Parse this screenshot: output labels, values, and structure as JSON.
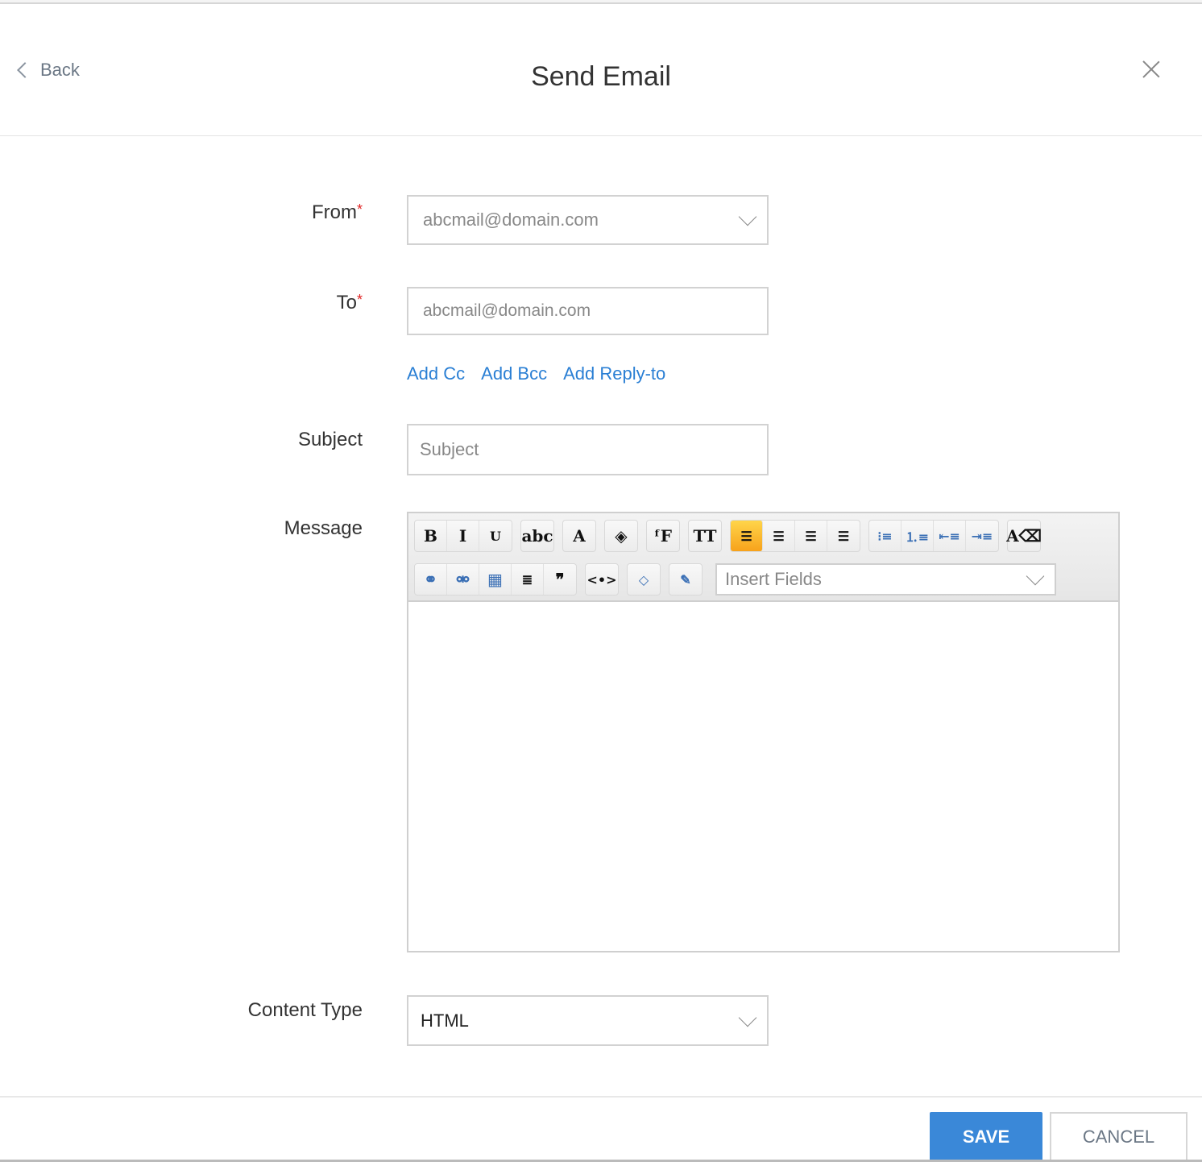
{
  "header": {
    "back_label": "Back",
    "title": "Send Email"
  },
  "form": {
    "from": {
      "label": "From",
      "required": "*",
      "value": "abcmail@domain.com"
    },
    "to": {
      "label": "To",
      "required": "*",
      "value": "abcmail@domain.com"
    },
    "links": {
      "add_cc": "Add Cc",
      "add_bcc": "Add Bcc",
      "add_reply_to": "Add Reply-to"
    },
    "subject": {
      "label": "Subject",
      "placeholder": "Subject"
    },
    "message": {
      "label": "Message",
      "insert_fields_placeholder": "Insert Fields"
    },
    "content_type": {
      "label": "Content Type",
      "value": "HTML"
    }
  },
  "toolbar": {
    "row1": [
      [
        {
          "name": "bold-icon",
          "glyph": "B"
        },
        {
          "name": "italic-icon",
          "glyph": "I"
        },
        {
          "name": "underline-icon",
          "glyph": "U"
        }
      ],
      [
        {
          "name": "strikethrough-icon",
          "glyph": "abc"
        }
      ],
      [
        {
          "name": "font-color-icon",
          "glyph": "A"
        }
      ],
      [
        {
          "name": "background-color-icon",
          "glyph": "◈"
        }
      ],
      [
        {
          "name": "font-family-icon",
          "glyph": "ᶠF"
        }
      ],
      [
        {
          "name": "font-size-icon",
          "glyph": "TT"
        }
      ],
      [
        {
          "name": "align-left-icon",
          "glyph": "☰",
          "active": true
        },
        {
          "name": "align-right-icon",
          "glyph": "☰"
        },
        {
          "name": "align-justify-icon",
          "glyph": "☰"
        },
        {
          "name": "align-center-icon",
          "glyph": "☰"
        }
      ],
      [
        {
          "name": "bulleted-list-icon",
          "glyph": "⁝≡"
        },
        {
          "name": "numbered-list-icon",
          "glyph": "⒈≡"
        },
        {
          "name": "outdent-icon",
          "glyph": "⇤≡"
        },
        {
          "name": "indent-icon",
          "glyph": "⇥≡"
        }
      ],
      [
        {
          "name": "clear-formatting-icon",
          "glyph": "A⌫"
        }
      ]
    ],
    "row2": [
      [
        {
          "name": "link-icon",
          "glyph": "⚭"
        },
        {
          "name": "unlink-icon",
          "glyph": "⚮"
        },
        {
          "name": "table-icon",
          "glyph": "▦"
        },
        {
          "name": "line-height-icon",
          "glyph": "≣"
        },
        {
          "name": "blockquote-icon",
          "glyph": "❞"
        }
      ],
      [
        {
          "name": "insert-code-icon",
          "glyph": "<•>"
        }
      ],
      [
        {
          "name": "source-icon",
          "glyph": "◇"
        }
      ],
      [
        {
          "name": "html-edit-icon",
          "glyph": "✎"
        }
      ]
    ]
  },
  "footer": {
    "save_label": "SAVE",
    "cancel_label": "CANCEL"
  }
}
